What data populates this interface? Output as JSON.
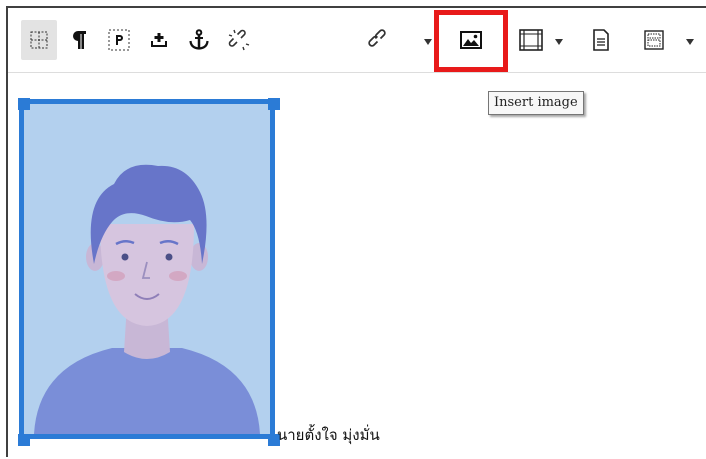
{
  "toolbar": {
    "buttons": [
      {
        "name": "show-blocks-icon",
        "active": true
      },
      {
        "name": "pilcrow-icon"
      },
      {
        "name": "paragraph-p-icon"
      },
      {
        "name": "insert-paragraph-icon"
      },
      {
        "name": "anchor-icon"
      },
      {
        "name": "unlink-icon"
      },
      {
        "name": "link-icon"
      },
      {
        "name": "insert-image-icon"
      },
      {
        "name": "insert-media-icon"
      },
      {
        "name": "insert-document-icon"
      },
      {
        "name": "insert-template-icon"
      }
    ],
    "highlight_color": "#e81a1a"
  },
  "tooltip": {
    "text": "Insert image"
  },
  "content": {
    "caption": "นายตั้งใจ มุ่งมั่น",
    "selection_color": "#2b7bd6",
    "image_background": "#b3d0ee"
  }
}
